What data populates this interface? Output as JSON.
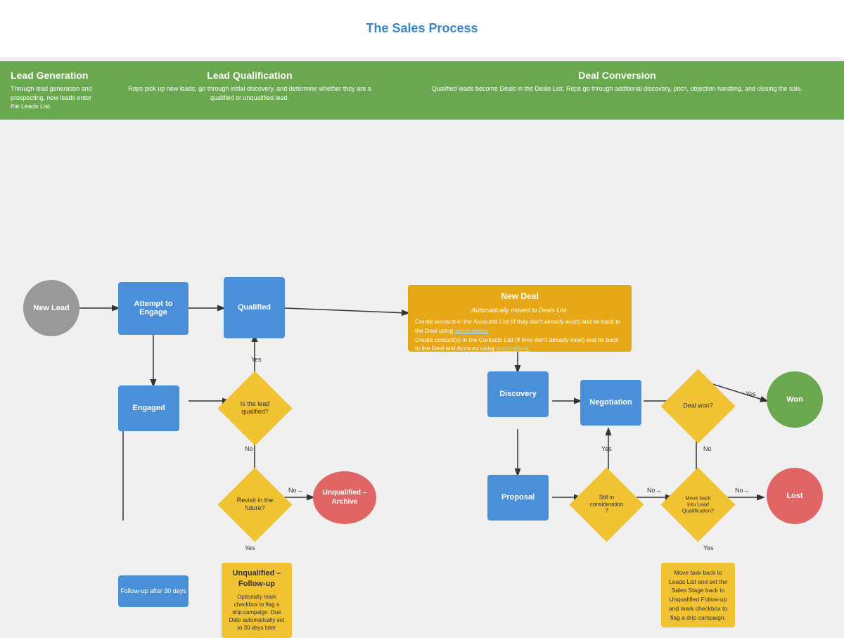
{
  "header": {
    "title": "The Sales Process"
  },
  "phases": [
    {
      "id": "phase-lead-gen",
      "title": "Lead Generation",
      "description": "Through lead generation and prospecting, new leads enter the Leads List."
    },
    {
      "id": "phase-lead-qual",
      "title": "Lead Qualification",
      "description": "Reps pick up new leads, go through initial discovery, and determine whether they are a qualified or unqualified lead."
    },
    {
      "id": "phase-deal-conv",
      "title": "Deal Conversion",
      "description": "Qualified leads become Deals in the Deals List. Reps go through additional discovery, pitch, objection handling, and closing the sale."
    }
  ],
  "nodes": {
    "new_lead": "New Lead",
    "attempt_to_engage": "Attempt to\nEngage",
    "engaged": "Engaged",
    "qualified": "Qualified",
    "is_lead_qualified": "Is the lead\nqualified?",
    "revisit_future": "Revisit in the\nfuture?",
    "unqualified_archive": "Unqualified –\nArchive",
    "unqualified_followup_title": "Unqualified –\nFollow-up",
    "unqualified_followup_desc": "Optionally mark checkbox to flag a drip campaign. Due Date automatically set to 30 days later",
    "followup_30": "Follow-up after 30 days",
    "new_deal_title": "New Deal",
    "new_deal_auto": "Automatically moved to Deals List.",
    "new_deal_body1": "Create account in the Accounts List (if they don't already exist) and tie back to the Deal using",
    "new_deal_link1": "automations.",
    "new_deal_body2": "Create contact(s) in the Contacts List (if they don't already exist) and tie back to the Deal and Account using",
    "new_deal_link2": "automations.",
    "discovery": "Discovery",
    "negotiation": "Negotiation",
    "proposal": "Proposal",
    "deal_won_q": "Deal won?",
    "still_consideration": "Still in\nconsideration\n?",
    "move_back_lead_qual": "Move back\ninto Lead\nQualification?",
    "won": "Won",
    "lost": "Lost",
    "lost_action": "Move task back to Leads List and set the Sales Stage back to Unqualified Follow-up and mark checkbox to flag a drip campaign."
  },
  "arrow_labels": {
    "yes": "Yes",
    "no": "No"
  },
  "colors": {
    "gray": "#999999",
    "blue": "#4a90d9",
    "green": "#6aa84f",
    "orange": "#e6a818",
    "yellow": "#f1c232",
    "red": "#e06666",
    "title_blue": "#3d85c8"
  }
}
